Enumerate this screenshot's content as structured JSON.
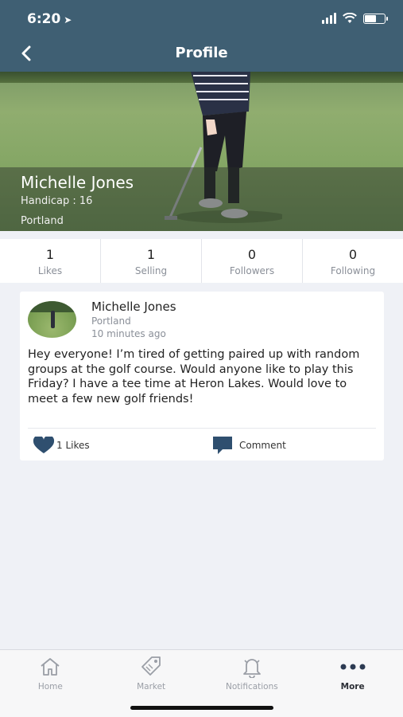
{
  "status_bar": {
    "time": "6:20",
    "location_icon": "location-arrow-icon"
  },
  "header": {
    "title": "Profile",
    "back_icon": "back-chevron-icon"
  },
  "profile": {
    "name": "Michelle Jones",
    "handicap": "Handicap : 16",
    "city": "Portland"
  },
  "stats": [
    {
      "value": "1",
      "label": "Likes"
    },
    {
      "value": "1",
      "label": "Selling"
    },
    {
      "value": "0",
      "label": "Followers"
    },
    {
      "value": "0",
      "label": "Following"
    }
  ],
  "post": {
    "author": "Michelle Jones",
    "city": "Portland",
    "time": "10 minutes ago",
    "body": "Hey everyone! I’m tired of getting paired up with random groups at the golf course. Would anyone like to play this Friday? I have a tee time at Heron Lakes. Would love to meet a few new golf friends!",
    "likes_label": "1 Likes",
    "comment_label": "Comment"
  },
  "tabs": [
    {
      "label": "Home",
      "icon": "home-icon",
      "active": false
    },
    {
      "label": "Market",
      "icon": "tag-icon",
      "active": false
    },
    {
      "label": "Notifications",
      "icon": "bell-icon",
      "active": false
    },
    {
      "label": "More",
      "icon": "more-dots-icon",
      "active": true
    }
  ],
  "colors": {
    "header": "#3f5f73",
    "accent_icon": "#2f4f6f",
    "background": "#eff1f6"
  }
}
